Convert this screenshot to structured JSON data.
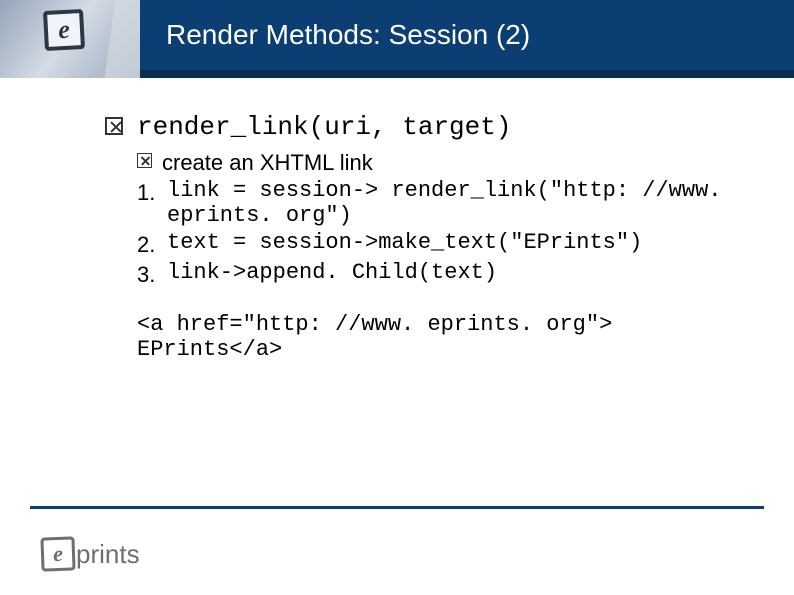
{
  "header": {
    "title": "Render Methods: Session (2)"
  },
  "main": {
    "call": "render_link(uri, target)",
    "sub": {
      "desc": "create an XHTML link",
      "steps": [
        "link = session-> render_link(\"http: //www. eprints. org\")",
        "text = session->make_text(\"EPrints\")",
        "link->append. Child(text)"
      ]
    },
    "output": {
      "line1": "<a href=\"http: //www. eprints. org\">",
      "line2": "EPrints</a>"
    }
  },
  "footer": {
    "brand": "prints",
    "icon_letter": "e"
  },
  "step_labels": [
    "1.",
    "2.",
    "3."
  ]
}
